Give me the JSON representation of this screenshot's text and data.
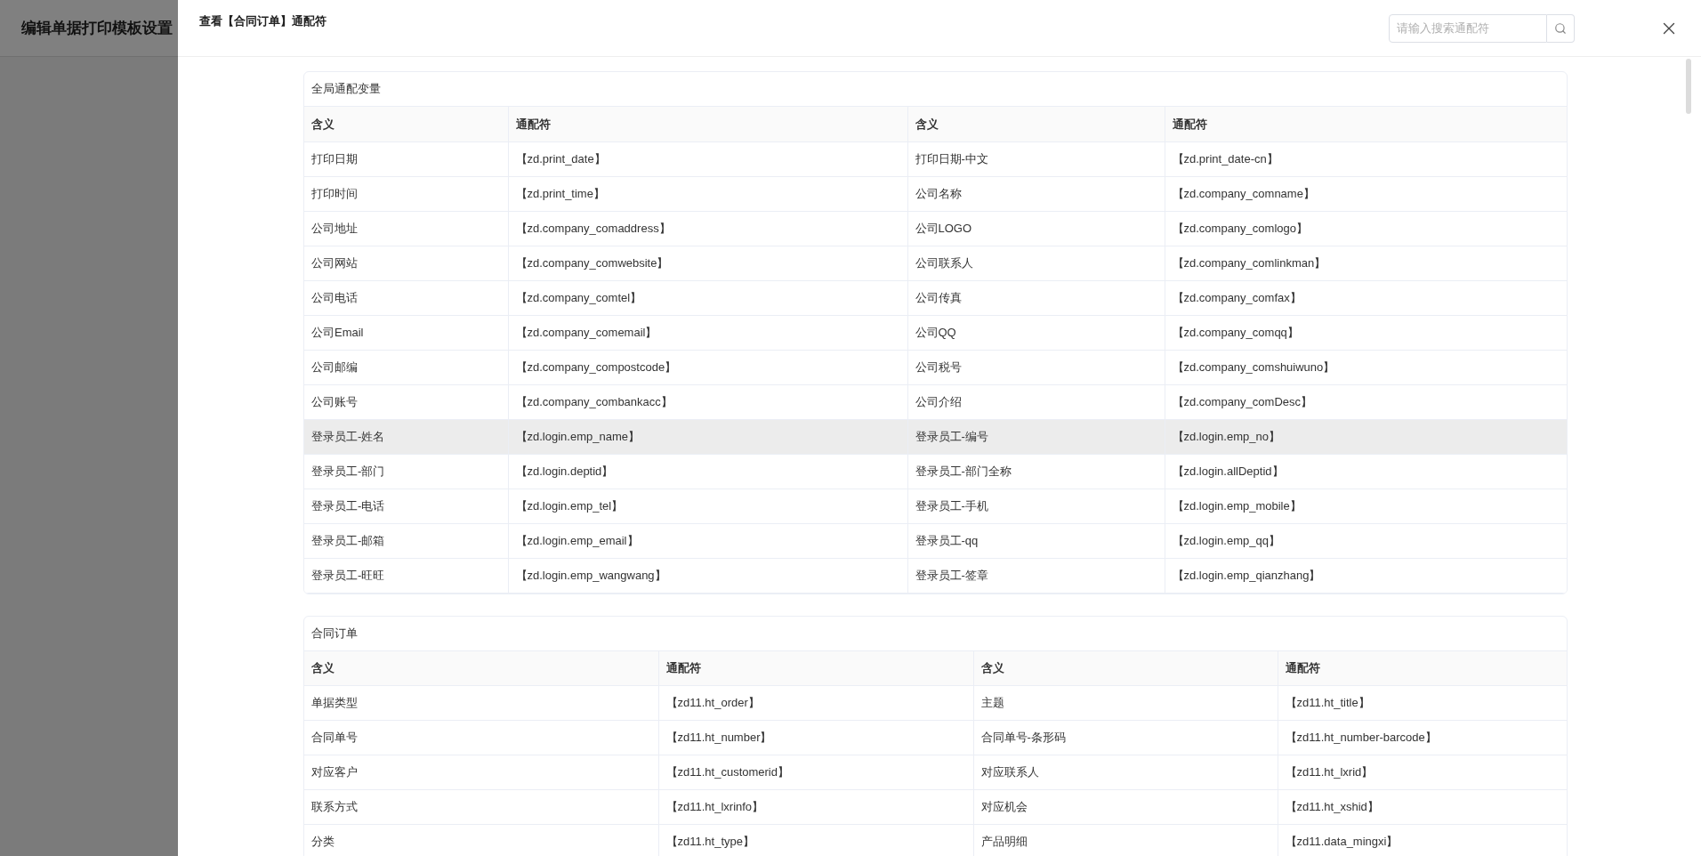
{
  "backdrop": {
    "title": "编辑单据打印模板设置"
  },
  "drawer": {
    "title": "查看【合同订单】通配符",
    "search": {
      "placeholder": "请输入搜索通配符"
    }
  },
  "sections": [
    {
      "title": "全局通配变量",
      "columns": [
        "含义",
        "通配符",
        "含义",
        "通配符"
      ],
      "rows": [
        {
          "cells": [
            "打印日期",
            "【zd.print_date】",
            "打印日期-中文",
            "【zd.print_date-cn】"
          ],
          "hovered": false
        },
        {
          "cells": [
            "打印时间",
            "【zd.print_time】",
            "公司名称",
            "【zd.company_comname】"
          ],
          "hovered": false
        },
        {
          "cells": [
            "公司地址",
            "【zd.company_comaddress】",
            "公司LOGO",
            "【zd.company_comlogo】"
          ],
          "hovered": false
        },
        {
          "cells": [
            "公司网站",
            "【zd.company_comwebsite】",
            "公司联系人",
            "【zd.company_comlinkman】"
          ],
          "hovered": false
        },
        {
          "cells": [
            "公司电话",
            "【zd.company_comtel】",
            "公司传真",
            "【zd.company_comfax】"
          ],
          "hovered": false
        },
        {
          "cells": [
            "公司Email",
            "【zd.company_comemail】",
            "公司QQ",
            "【zd.company_comqq】"
          ],
          "hovered": false
        },
        {
          "cells": [
            "公司邮编",
            "【zd.company_compostcode】",
            "公司税号",
            "【zd.company_comshuiwuno】"
          ],
          "hovered": false
        },
        {
          "cells": [
            "公司账号",
            "【zd.company_combankacc】",
            "公司介绍",
            "【zd.company_comDesc】"
          ],
          "hovered": false
        },
        {
          "cells": [
            "登录员工-姓名",
            "【zd.login.emp_name】",
            "登录员工-编号",
            "【zd.login.emp_no】"
          ],
          "hovered": true
        },
        {
          "cells": [
            "登录员工-部门",
            "【zd.login.deptid】",
            "登录员工-部门全称",
            "【zd.login.allDeptid】"
          ],
          "hovered": false
        },
        {
          "cells": [
            "登录员工-电话",
            "【zd.login.emp_tel】",
            "登录员工-手机",
            "【zd.login.emp_mobile】"
          ],
          "hovered": false
        },
        {
          "cells": [
            "登录员工-邮箱",
            "【zd.login.emp_email】",
            "登录员工-qq",
            "【zd.login.emp_qq】"
          ],
          "hovered": false
        },
        {
          "cells": [
            "登录员工-旺旺",
            "【zd.login.emp_wangwang】",
            "登录员工-签章",
            "【zd.login.emp_qianzhang】"
          ],
          "hovered": false
        }
      ]
    },
    {
      "title": "合同订单",
      "columns": [
        "含义",
        "通配符",
        "含义",
        "通配符"
      ],
      "rows": [
        {
          "cells": [
            "单据类型",
            "【zd11.ht_order】",
            "主题",
            "【zd11.ht_title】"
          ],
          "hovered": false
        },
        {
          "cells": [
            "合同单号",
            "【zd11.ht_number】",
            "合同单号-条形码",
            "【zd11.ht_number-barcode】"
          ],
          "hovered": false
        },
        {
          "cells": [
            "对应客户",
            "【zd11.ht_customerid】",
            "对应联系人",
            "【zd11.ht_lxrid】"
          ],
          "hovered": false
        },
        {
          "cells": [
            "联系方式",
            "【zd11.ht_lxrinfo】",
            "对应机会",
            "【zd11.ht_xshid】"
          ],
          "hovered": false
        },
        {
          "cells": [
            "分类",
            "【zd11.ht_type】",
            "产品明细",
            "【zd11.data_mingxi】"
          ],
          "hovered": false
        }
      ]
    }
  ]
}
